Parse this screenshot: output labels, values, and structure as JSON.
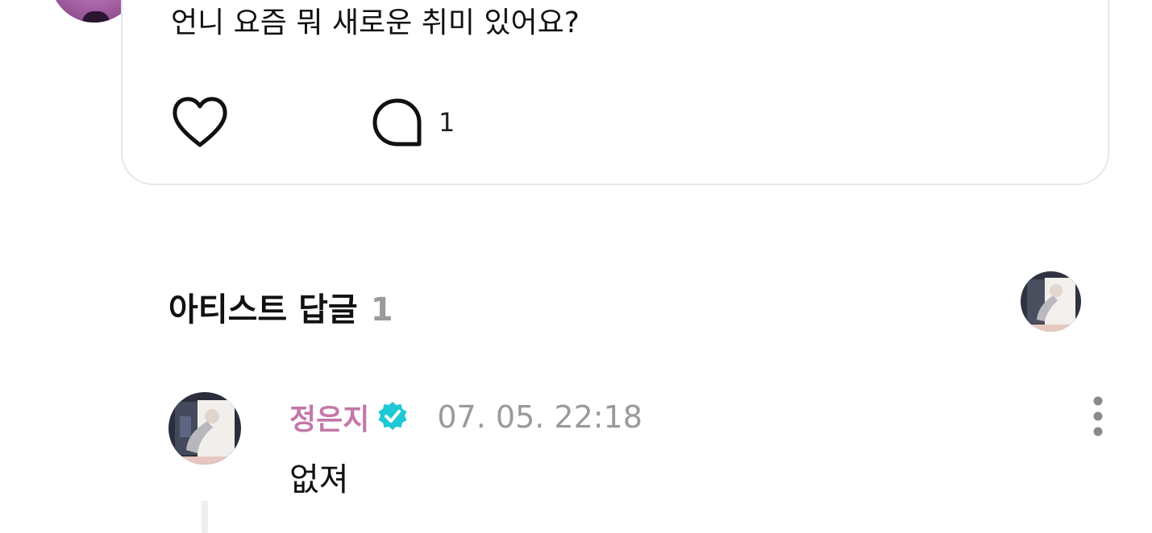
{
  "post": {
    "text": "언니 요즘 뭐 새로운 취미 있어요?",
    "comment_count": "1"
  },
  "artist_replies": {
    "title": "아티스트 답글",
    "count": "1"
  },
  "reply": {
    "author": "정은지",
    "timestamp": "07. 05. 22:18",
    "text": "없져"
  },
  "icons": {
    "like": "heart-icon",
    "comment": "speech-bubble-icon",
    "verified": "verified-badge-icon",
    "more": "vertical-ellipsis-icon"
  },
  "colors": {
    "author_name": "#c378a8",
    "verified_badge": "#1ec8d6",
    "muted_text": "#9a9a9a",
    "card_border": "#e7e7ea"
  }
}
